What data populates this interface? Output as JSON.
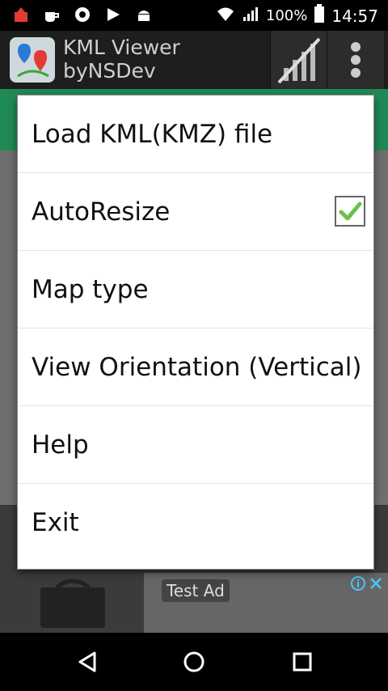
{
  "status_bar": {
    "battery_percent": "100%",
    "time": "14:57",
    "left_icons": [
      "app-notification-icon",
      "coffee-icon",
      "eye-icon",
      "play-store-icon",
      "android-icon"
    ],
    "right_icons": [
      "wifi-icon",
      "signal-icon",
      "battery-icon"
    ]
  },
  "app_bar": {
    "title_line1": "KML Viewer",
    "title_line2": "byNSDev",
    "actions": [
      "signal-chart-icon",
      "overflow-menu-icon"
    ]
  },
  "menu": {
    "items": [
      {
        "label": "Load KML(KMZ) file"
      },
      {
        "label": "AutoResize",
        "checked": true
      },
      {
        "label": "Map type"
      },
      {
        "label": "View Orientation (Vertical)"
      },
      {
        "label": "Help"
      },
      {
        "label": "Exit"
      }
    ]
  },
  "ad": {
    "badge": "Test Ad"
  },
  "nav_bar": {
    "buttons": [
      "back-icon",
      "home-icon",
      "recents-icon"
    ]
  },
  "colors": {
    "green_bar": "#1f8a55",
    "checkmark": "#6cc04a"
  }
}
